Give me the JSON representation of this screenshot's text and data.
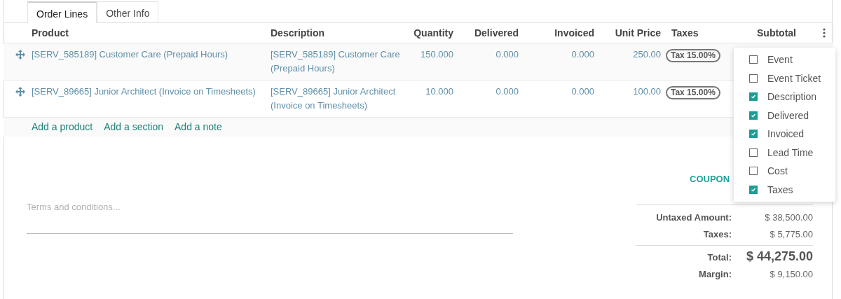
{
  "tabs": [
    {
      "label": "Order Lines",
      "selected": true
    },
    {
      "label": "Other Info",
      "selected": false
    }
  ],
  "table": {
    "columns": [
      "Product",
      "Description",
      "Quantity",
      "Delivered",
      "Invoiced",
      "Unit Price",
      "Taxes",
      "Subtotal"
    ],
    "rows": [
      {
        "product": "[SERV_585189] Customer Care (Prepaid Hours)",
        "description": "[SERV_585189] Customer Care (Prepaid Hours)",
        "quantity": "150.000",
        "delivered": "0.000",
        "invoiced": "0.000",
        "unit_price": "250.00",
        "taxes": "Tax 15.00%"
      },
      {
        "product": "[SERV_89665] Junior Architect (Invoice on Timesheets)",
        "description": "[SERV_89665] Junior Architect (Invoice on Timesheets)",
        "quantity": "10.000",
        "delivered": "0.000",
        "invoiced": "0.000",
        "unit_price": "100.00",
        "taxes": "Tax 15.00%"
      }
    ],
    "add_links": [
      "Add a product",
      "Add a section",
      "Add a note"
    ]
  },
  "column_menu": [
    {
      "label": "Event",
      "checked": false
    },
    {
      "label": "Event Ticket",
      "checked": false
    },
    {
      "label": "Description",
      "checked": true
    },
    {
      "label": "Delivered",
      "checked": true
    },
    {
      "label": "Invoiced",
      "checked": true
    },
    {
      "label": "Lead Time",
      "checked": false
    },
    {
      "label": "Cost",
      "checked": false
    },
    {
      "label": "Taxes",
      "checked": true
    }
  ],
  "coupon_button": "COUPON",
  "terms": {
    "placeholder": "Terms and conditions..."
  },
  "totals": [
    {
      "label": "Untaxed Amount:",
      "value": "$ 38,500.00",
      "kind": "normal"
    },
    {
      "label": "Taxes:",
      "value": "$ 5,775.00",
      "kind": "normal"
    },
    {
      "label": "Total:",
      "value": "$ 44,275.00",
      "kind": "total"
    },
    {
      "label": "Margin:",
      "value": "$ 9,150.00",
      "kind": "normal"
    }
  ]
}
